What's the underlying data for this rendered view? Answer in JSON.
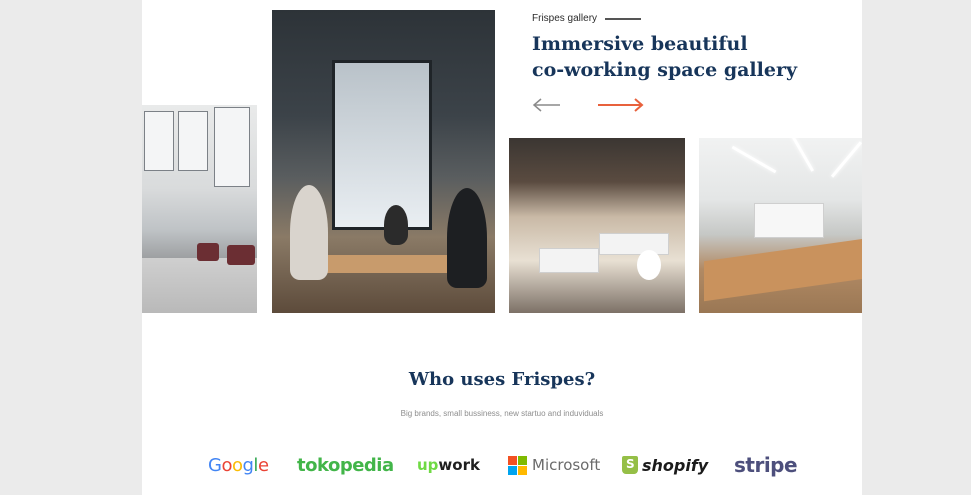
{
  "gallery": {
    "label": "Frispes gallery",
    "headline_line1": "Immersive beautiful",
    "headline_line2": "co-working space gallery",
    "prev_arrow_icon": "arrow-left-icon",
    "next_arrow_icon": "arrow-right-icon",
    "photos": [
      {
        "name": "gallery-photo-lobby"
      },
      {
        "name": "gallery-photo-team-meeting"
      },
      {
        "name": "gallery-photo-open-office"
      },
      {
        "name": "gallery-photo-conference-room"
      }
    ]
  },
  "clients": {
    "title": "Who uses Frispes?",
    "subtitle": "Big brands, small bussiness, new startuo and induviduals",
    "logos": {
      "google": "Google",
      "tokopedia": "tokopedia",
      "upwork_up": "up",
      "upwork_work": "work",
      "microsoft": "Microsoft",
      "shopify": "shopify",
      "stripe": "stripe"
    }
  },
  "colors": {
    "heading": "#17355a",
    "accent_arrow": "#e8613c",
    "muted_arrow": "#8a8a8a"
  }
}
